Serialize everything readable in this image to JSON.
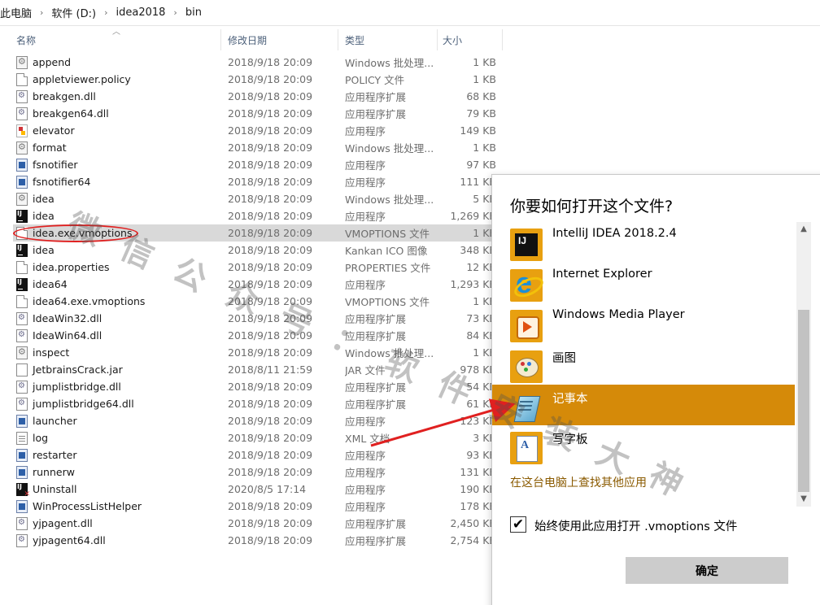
{
  "breadcrumb": [
    "此电脑",
    "软件 (D:)",
    "idea2018",
    "bin"
  ],
  "columns": {
    "name": "名称",
    "date": "修改日期",
    "type": "类型",
    "size": "大小"
  },
  "files": [
    {
      "name": "append",
      "date": "2018/9/18 20:09",
      "type": "Windows 批处理...",
      "size": "1 KB",
      "icon": "bat"
    },
    {
      "name": "appletviewer.policy",
      "date": "2018/9/18 20:09",
      "type": "POLICY 文件",
      "size": "1 KB",
      "icon": "doc"
    },
    {
      "name": "breakgen.dll",
      "date": "2018/9/18 20:09",
      "type": "应用程序扩展",
      "size": "68 KB",
      "icon": "dll"
    },
    {
      "name": "breakgen64.dll",
      "date": "2018/9/18 20:09",
      "type": "应用程序扩展",
      "size": "79 KB",
      "icon": "dll"
    },
    {
      "name": "elevator",
      "date": "2018/9/18 20:09",
      "type": "应用程序",
      "size": "149 KB",
      "icon": "elev"
    },
    {
      "name": "format",
      "date": "2018/9/18 20:09",
      "type": "Windows 批处理...",
      "size": "1 KB",
      "icon": "bat"
    },
    {
      "name": "fsnotifier",
      "date": "2018/9/18 20:09",
      "type": "应用程序",
      "size": "97 KB",
      "icon": "exe"
    },
    {
      "name": "fsnotifier64",
      "date": "2018/9/18 20:09",
      "type": "应用程序",
      "size": "111 KB",
      "icon": "exe"
    },
    {
      "name": "idea",
      "date": "2018/9/18 20:09",
      "type": "Windows 批处理...",
      "size": "5 KB",
      "icon": "bat"
    },
    {
      "name": "idea",
      "date": "2018/9/18 20:09",
      "type": "应用程序",
      "size": "1,269 KB",
      "icon": "ij"
    },
    {
      "name": "idea.exe.vmoptions",
      "date": "2018/9/18 20:09",
      "type": "VMOPTIONS 文件",
      "size": "1 KB",
      "icon": "doc",
      "selected": true
    },
    {
      "name": "idea",
      "date": "2018/9/18 20:09",
      "type": "Kankan ICO 图像",
      "size": "348 KB",
      "icon": "ij"
    },
    {
      "name": "idea.properties",
      "date": "2018/9/18 20:09",
      "type": "PROPERTIES 文件",
      "size": "12 KB",
      "icon": "doc"
    },
    {
      "name": "idea64",
      "date": "2018/9/18 20:09",
      "type": "应用程序",
      "size": "1,293 KB",
      "icon": "ij"
    },
    {
      "name": "idea64.exe.vmoptions",
      "date": "2018/9/18 20:09",
      "type": "VMOPTIONS 文件",
      "size": "1 KB",
      "icon": "doc"
    },
    {
      "name": "IdeaWin32.dll",
      "date": "2018/9/18 20:09",
      "type": "应用程序扩展",
      "size": "73 KB",
      "icon": "dll"
    },
    {
      "name": "IdeaWin64.dll",
      "date": "2018/9/18 20:09",
      "type": "应用程序扩展",
      "size": "84 KB",
      "icon": "dll"
    },
    {
      "name": "inspect",
      "date": "2018/9/18 20:09",
      "type": "Windows 批处理...",
      "size": "1 KB",
      "icon": "bat"
    },
    {
      "name": "JetbrainsCrack.jar",
      "date": "2018/8/11 21:59",
      "type": "JAR 文件",
      "size": "978 KB",
      "icon": "jar"
    },
    {
      "name": "jumplistbridge.dll",
      "date": "2018/9/18 20:09",
      "type": "应用程序扩展",
      "size": "54 KB",
      "icon": "dll"
    },
    {
      "name": "jumplistbridge64.dll",
      "date": "2018/9/18 20:09",
      "type": "应用程序扩展",
      "size": "61 KB",
      "icon": "dll"
    },
    {
      "name": "launcher",
      "date": "2018/9/18 20:09",
      "type": "应用程序",
      "size": "123 KB",
      "icon": "exe"
    },
    {
      "name": "log",
      "date": "2018/9/18 20:09",
      "type": "XML 文档",
      "size": "3 KB",
      "icon": "xml"
    },
    {
      "name": "restarter",
      "date": "2018/9/18 20:09",
      "type": "应用程序",
      "size": "93 KB",
      "icon": "exe"
    },
    {
      "name": "runnerw",
      "date": "2018/9/18 20:09",
      "type": "应用程序",
      "size": "131 KB",
      "icon": "exe"
    },
    {
      "name": "Uninstall",
      "date": "2020/8/5 17:14",
      "type": "应用程序",
      "size": "190 KB",
      "icon": "unin"
    },
    {
      "name": "WinProcessListHelper",
      "date": "2018/9/18 20:09",
      "type": "应用程序",
      "size": "178 KB",
      "icon": "exe"
    },
    {
      "name": "yjpagent.dll",
      "date": "2018/9/18 20:09",
      "type": "应用程序扩展",
      "size": "2,450 KB",
      "icon": "dll"
    },
    {
      "name": "yjpagent64.dll",
      "date": "2018/9/18 20:09",
      "type": "应用程序扩展",
      "size": "2,754 KB",
      "icon": "dll"
    }
  ],
  "dialog": {
    "title": "你要如何打开这个文件?",
    "apps": [
      {
        "name": "IntelliJ IDEA 2018.2.4",
        "icon": "intellij"
      },
      {
        "name": "Internet Explorer",
        "icon": "ie"
      },
      {
        "name": "Windows Media Player",
        "icon": "wmp"
      },
      {
        "name": "画图",
        "icon": "paint"
      },
      {
        "name": "记事本",
        "icon": "notepad",
        "selected": true
      },
      {
        "name": "写字板",
        "icon": "wordpad"
      }
    ],
    "more_link": "在这台电脑上查找其他应用",
    "always_use_label": "始终使用此应用打开 .vmoptions 文件",
    "always_use_checked": true,
    "ok_label": "确定"
  },
  "watermark": "微信公众号：软件安装大神",
  "colors": {
    "selected_app": "#d58a09",
    "annotation_red": "#e02020",
    "row_highlight": "#d9d9d9"
  }
}
